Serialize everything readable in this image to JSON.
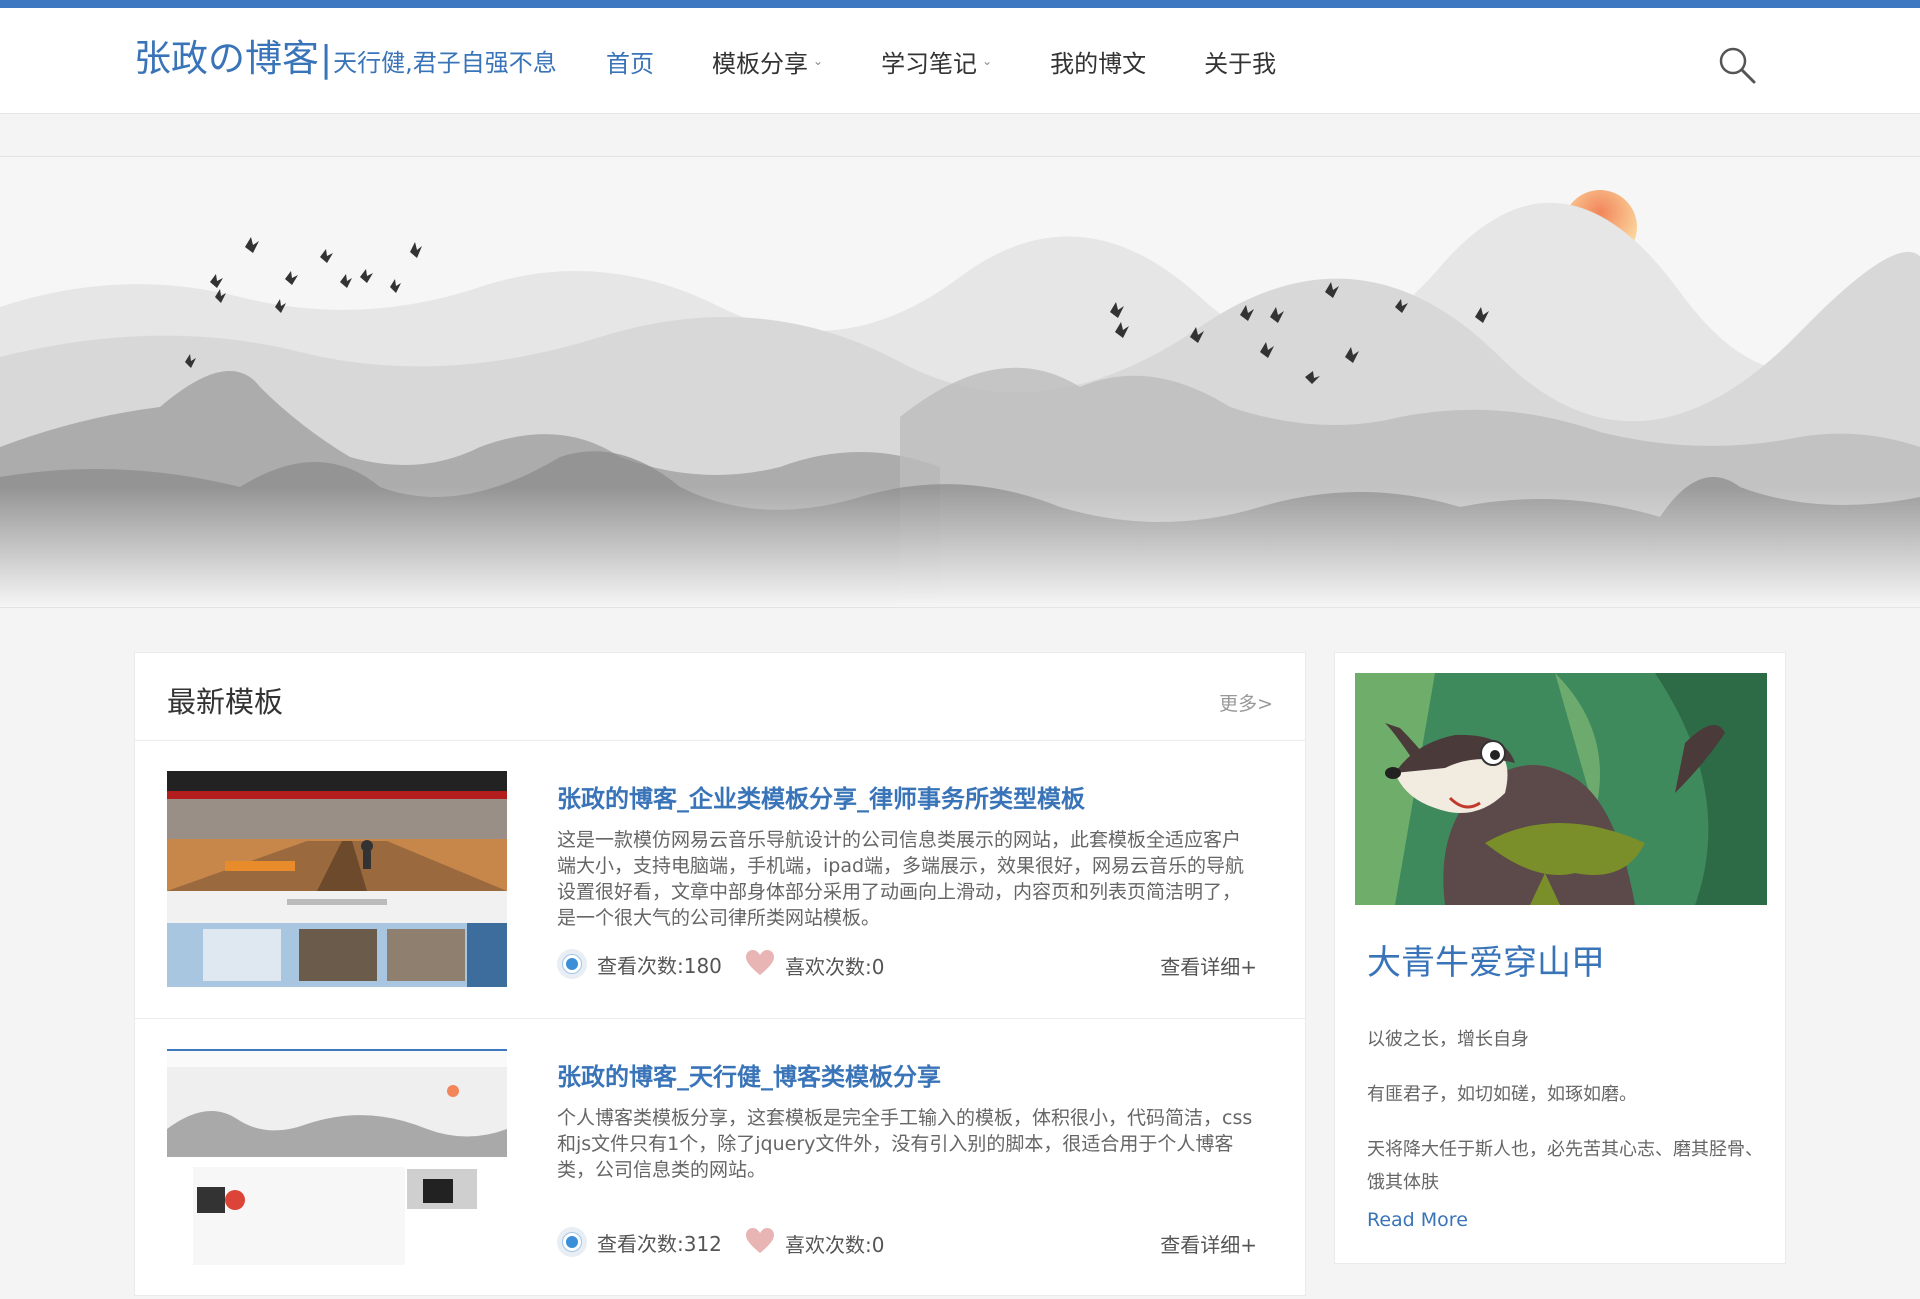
{
  "header": {
    "logo_main": "张政の博客",
    "logo_bar": "|",
    "logo_sub": "天行健,君子自强不息",
    "nav": [
      {
        "label": "首页",
        "active": true,
        "dropdown": false
      },
      {
        "label": "模板分享",
        "active": false,
        "dropdown": true
      },
      {
        "label": "学习笔记",
        "active": false,
        "dropdown": true
      },
      {
        "label": "我的博文",
        "active": false,
        "dropdown": false
      },
      {
        "label": "关于我",
        "active": false,
        "dropdown": false
      }
    ],
    "search_icon": "search-icon"
  },
  "latest": {
    "title": "最新模板",
    "more": "更多>",
    "articles": [
      {
        "title": "张政的博客_企业类模板分享_律师事务所类型模板",
        "desc": "这是一款模仿网易云音乐导航设计的公司信息类展示的网站，此套模板全适应客户端大小，支持电脑端，手机端，ipad端，多端展示，效果很好，网易云音乐的导航设置很好看，文章中部身体部分采用了动画向上滑动，内容页和列表页简洁明了，是一个很大气的公司律所类网站模板。",
        "views": "查看次数:180",
        "likes": "喜欢次数:0",
        "detail": "查看详细+"
      },
      {
        "title": "张政的博客_天行健_博客类模板分享",
        "desc": "个人博客类模板分享，这套模板是完全手工输入的模板，体积很小，代码简洁，css和js文件只有1个，除了jquery文件外，没有引入别的脚本，很适合用于个人博客类，公司信息类的网站。",
        "views": "查看次数:312",
        "likes": "喜欢次数:0",
        "detail": "查看详细+"
      }
    ]
  },
  "sidebar": {
    "title": "大青牛爱穿山甲",
    "lines": [
      "以彼之长，增长自身",
      "有匪君子，如切如磋，如琢如磨。",
      "天将降大任于斯人也，必先苦其心志、磨其胫骨、饿其体肤"
    ],
    "read_more": "Read More"
  },
  "colors": {
    "accent": "#3a74b8",
    "top_line": "#3e78c0",
    "heart": "#e8b4b4"
  }
}
